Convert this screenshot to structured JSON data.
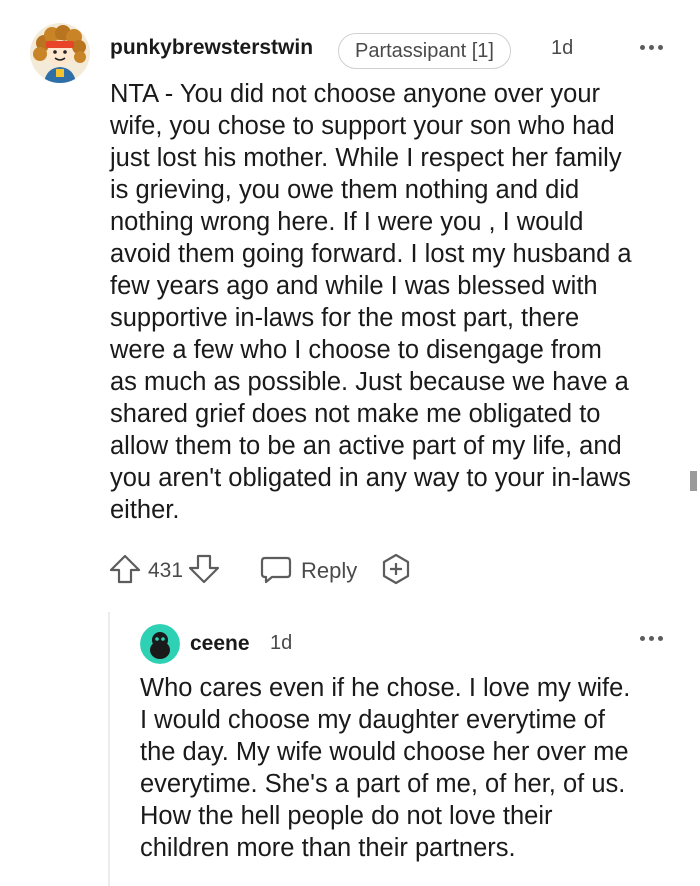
{
  "comment": {
    "username": "punkybrewsterstwin",
    "flair": "Partassipant [1]",
    "time": "1d",
    "text": "NTA - You did not choose anyone over your\nwife, you chose to support your son who had\njust lost his mother. While I respect her family\nis grieving, you owe them nothing and did\nnothing wrong here. If I were you , I would\navoid them going forward. I lost my husband a\nfew years ago and while I was blessed with\nsupportive in-laws for the most part, there\nwere a few who I choose to disengage from\nas much as possible. Just because we have a\nshared grief does not make me obligated to\nallow them to be an active part of my life, and\nyou aren't obligated in any way to your in-laws\neither.",
    "score": "431",
    "reply_label": "Reply",
    "icons": {
      "avatar": "user-avatar-icon",
      "upvote": "upvote-arrow-icon",
      "downvote": "downvote-arrow-icon",
      "reply": "chat-bubble-icon",
      "award": "add-award-icon",
      "more": "more-options-icon"
    }
  },
  "reply": {
    "username": "ceene",
    "time": "1d",
    "text": "Who cares even if he chose. I love my wife.\nI would choose my daughter everytime of\nthe day. My wife would choose her over me\neverytime. She's a part of me, of her, of us.\nHow the hell people do not love their\nchildren more than their partners.",
    "avatar_color": "#2fd1b4"
  },
  "colors": {
    "text": "#1a1a1b",
    "muted": "#4a4a4a",
    "icon": "#5c5c5c"
  }
}
